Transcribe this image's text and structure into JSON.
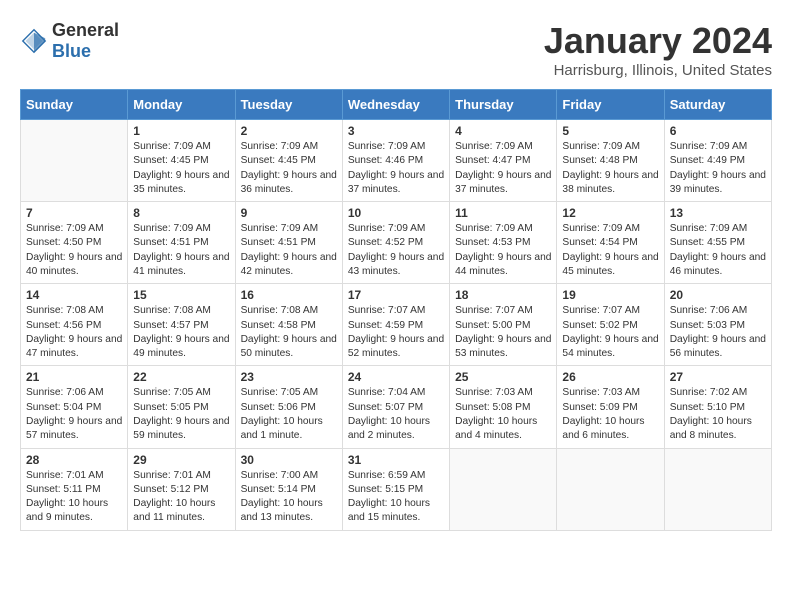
{
  "header": {
    "logo_general": "General",
    "logo_blue": "Blue",
    "title": "January 2024",
    "subtitle": "Harrisburg, Illinois, United States"
  },
  "weekdays": [
    "Sunday",
    "Monday",
    "Tuesday",
    "Wednesday",
    "Thursday",
    "Friday",
    "Saturday"
  ],
  "weeks": [
    [
      {
        "day": "",
        "empty": true
      },
      {
        "day": "1",
        "sunrise": "7:09 AM",
        "sunset": "4:45 PM",
        "daylight": "9 hours and 35 minutes."
      },
      {
        "day": "2",
        "sunrise": "7:09 AM",
        "sunset": "4:45 PM",
        "daylight": "9 hours and 36 minutes."
      },
      {
        "day": "3",
        "sunrise": "7:09 AM",
        "sunset": "4:46 PM",
        "daylight": "9 hours and 37 minutes."
      },
      {
        "day": "4",
        "sunrise": "7:09 AM",
        "sunset": "4:47 PM",
        "daylight": "9 hours and 37 minutes."
      },
      {
        "day": "5",
        "sunrise": "7:09 AM",
        "sunset": "4:48 PM",
        "daylight": "9 hours and 38 minutes."
      },
      {
        "day": "6",
        "sunrise": "7:09 AM",
        "sunset": "4:49 PM",
        "daylight": "9 hours and 39 minutes."
      }
    ],
    [
      {
        "day": "7",
        "sunrise": "7:09 AM",
        "sunset": "4:50 PM",
        "daylight": "9 hours and 40 minutes."
      },
      {
        "day": "8",
        "sunrise": "7:09 AM",
        "sunset": "4:51 PM",
        "daylight": "9 hours and 41 minutes."
      },
      {
        "day": "9",
        "sunrise": "7:09 AM",
        "sunset": "4:51 PM",
        "daylight": "9 hours and 42 minutes."
      },
      {
        "day": "10",
        "sunrise": "7:09 AM",
        "sunset": "4:52 PM",
        "daylight": "9 hours and 43 minutes."
      },
      {
        "day": "11",
        "sunrise": "7:09 AM",
        "sunset": "4:53 PM",
        "daylight": "9 hours and 44 minutes."
      },
      {
        "day": "12",
        "sunrise": "7:09 AM",
        "sunset": "4:54 PM",
        "daylight": "9 hours and 45 minutes."
      },
      {
        "day": "13",
        "sunrise": "7:09 AM",
        "sunset": "4:55 PM",
        "daylight": "9 hours and 46 minutes."
      }
    ],
    [
      {
        "day": "14",
        "sunrise": "7:08 AM",
        "sunset": "4:56 PM",
        "daylight": "9 hours and 47 minutes."
      },
      {
        "day": "15",
        "sunrise": "7:08 AM",
        "sunset": "4:57 PM",
        "daylight": "9 hours and 49 minutes."
      },
      {
        "day": "16",
        "sunrise": "7:08 AM",
        "sunset": "4:58 PM",
        "daylight": "9 hours and 50 minutes."
      },
      {
        "day": "17",
        "sunrise": "7:07 AM",
        "sunset": "4:59 PM",
        "daylight": "9 hours and 52 minutes."
      },
      {
        "day": "18",
        "sunrise": "7:07 AM",
        "sunset": "5:00 PM",
        "daylight": "9 hours and 53 minutes."
      },
      {
        "day": "19",
        "sunrise": "7:07 AM",
        "sunset": "5:02 PM",
        "daylight": "9 hours and 54 minutes."
      },
      {
        "day": "20",
        "sunrise": "7:06 AM",
        "sunset": "5:03 PM",
        "daylight": "9 hours and 56 minutes."
      }
    ],
    [
      {
        "day": "21",
        "sunrise": "7:06 AM",
        "sunset": "5:04 PM",
        "daylight": "9 hours and 57 minutes."
      },
      {
        "day": "22",
        "sunrise": "7:05 AM",
        "sunset": "5:05 PM",
        "daylight": "9 hours and 59 minutes."
      },
      {
        "day": "23",
        "sunrise": "7:05 AM",
        "sunset": "5:06 PM",
        "daylight": "10 hours and 1 minute."
      },
      {
        "day": "24",
        "sunrise": "7:04 AM",
        "sunset": "5:07 PM",
        "daylight": "10 hours and 2 minutes."
      },
      {
        "day": "25",
        "sunrise": "7:03 AM",
        "sunset": "5:08 PM",
        "daylight": "10 hours and 4 minutes."
      },
      {
        "day": "26",
        "sunrise": "7:03 AM",
        "sunset": "5:09 PM",
        "daylight": "10 hours and 6 minutes."
      },
      {
        "day": "27",
        "sunrise": "7:02 AM",
        "sunset": "5:10 PM",
        "daylight": "10 hours and 8 minutes."
      }
    ],
    [
      {
        "day": "28",
        "sunrise": "7:01 AM",
        "sunset": "5:11 PM",
        "daylight": "10 hours and 9 minutes."
      },
      {
        "day": "29",
        "sunrise": "7:01 AM",
        "sunset": "5:12 PM",
        "daylight": "10 hours and 11 minutes."
      },
      {
        "day": "30",
        "sunrise": "7:00 AM",
        "sunset": "5:14 PM",
        "daylight": "10 hours and 13 minutes."
      },
      {
        "day": "31",
        "sunrise": "6:59 AM",
        "sunset": "5:15 PM",
        "daylight": "10 hours and 15 minutes."
      },
      {
        "day": "",
        "empty": true
      },
      {
        "day": "",
        "empty": true
      },
      {
        "day": "",
        "empty": true
      }
    ]
  ]
}
